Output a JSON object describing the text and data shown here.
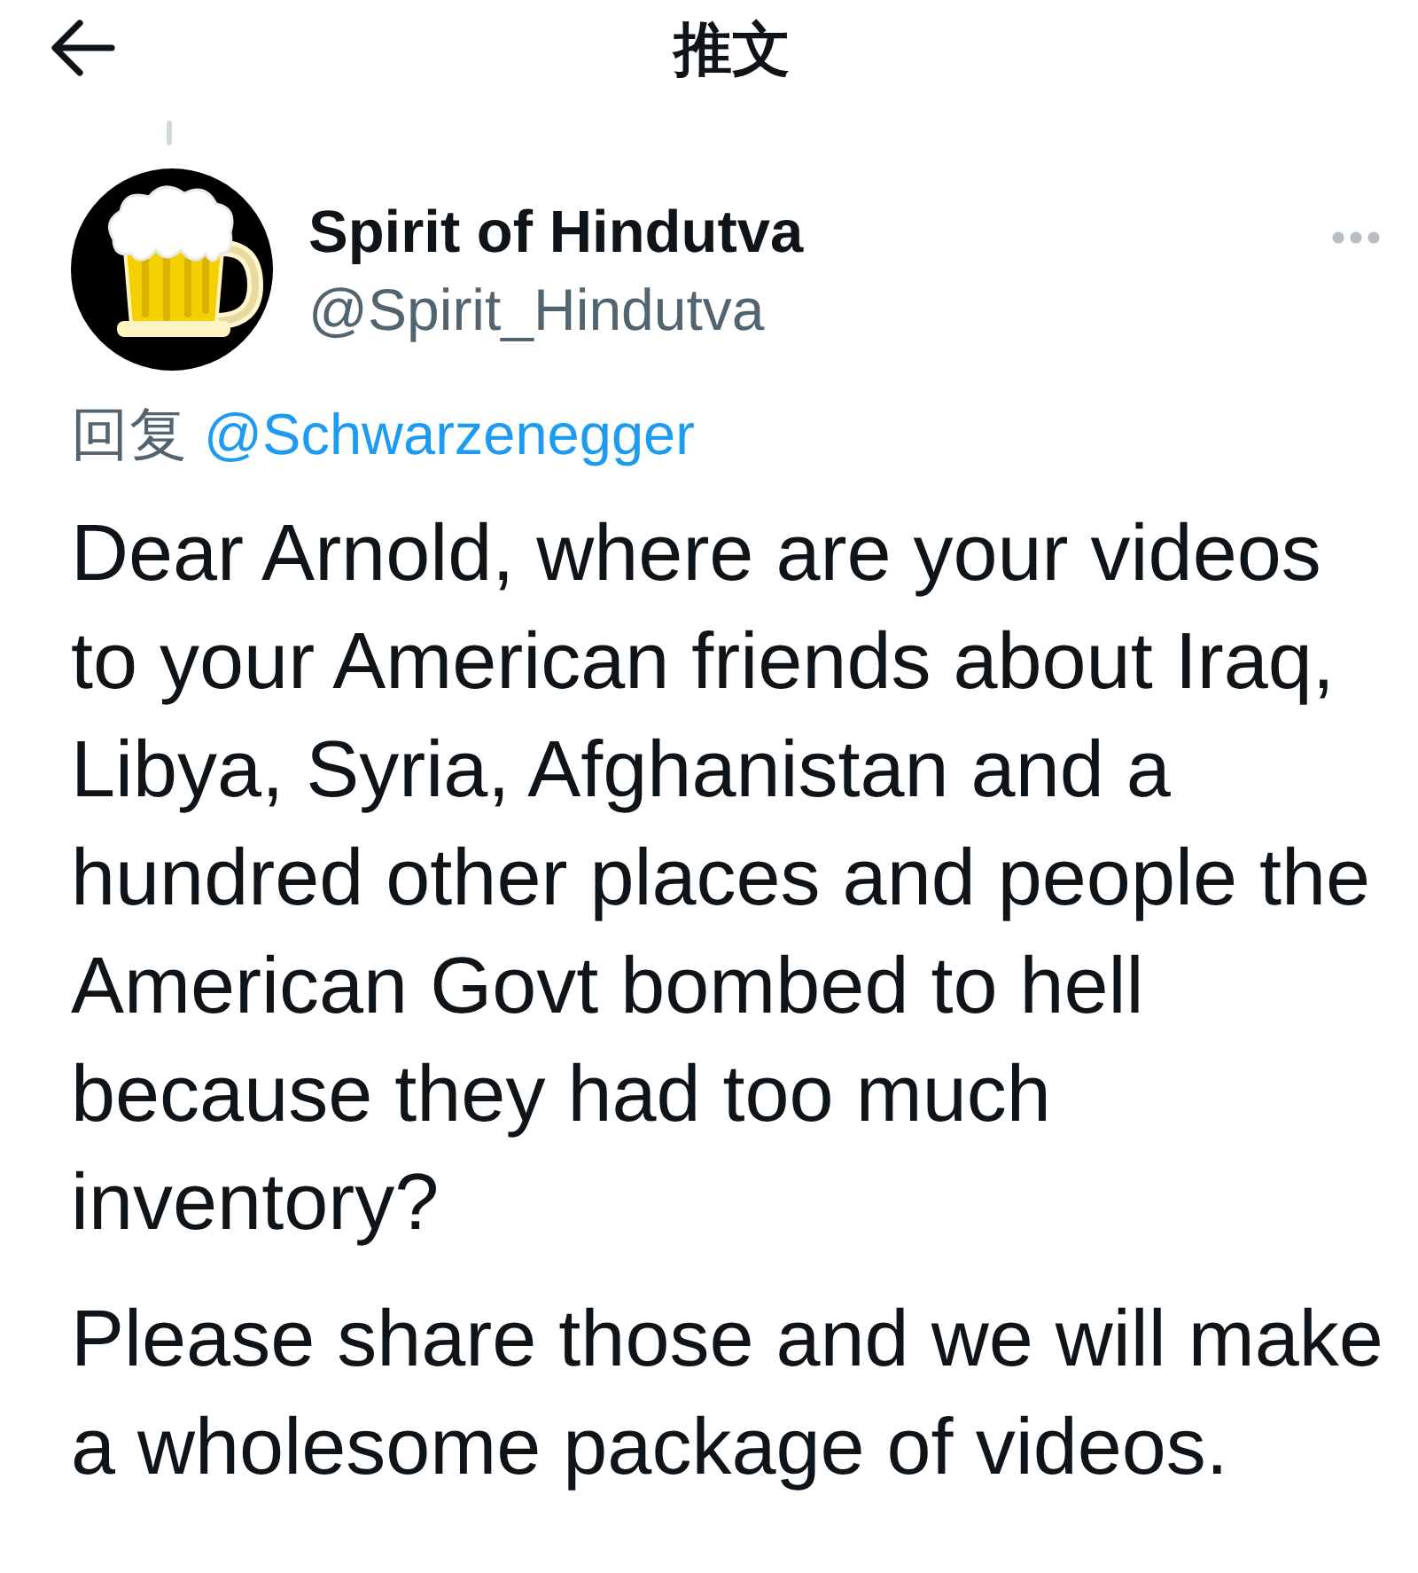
{
  "header": {
    "title": "推文"
  },
  "tweet": {
    "author_name": "Spirit of Hindutva",
    "author_handle": "@Spirit_Hindutva",
    "reply_label": "回复",
    "reply_to": "@Schwarzenegger",
    "paragraphs": [
      "Dear Arnold, where are your videos to your American friends about Iraq, Libya, Syria, Afghanistan and a hundred other places and people the American Govt bombed to hell because they had too much inventory?",
      "Please share those and we will make a wholesome package of videos."
    ]
  }
}
